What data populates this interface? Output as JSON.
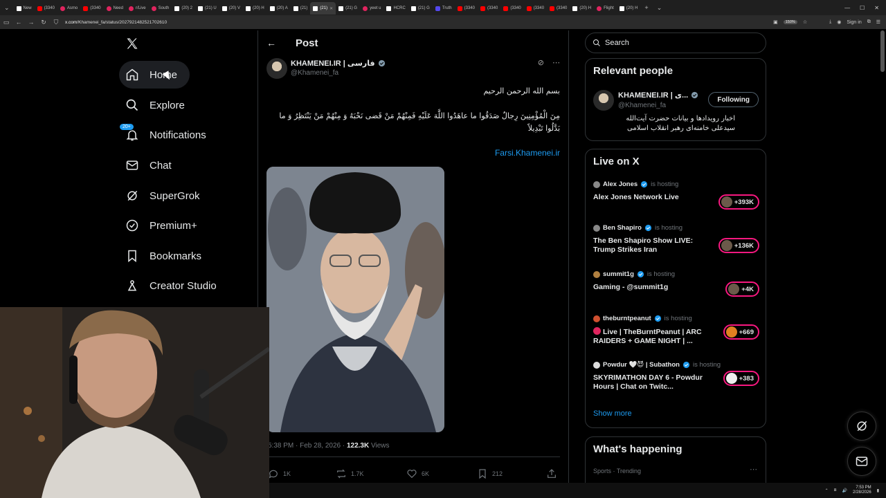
{
  "browser": {
    "tabs": [
      {
        "label": "New",
        "fav": "x"
      },
      {
        "label": "(3340",
        "fav": "yt"
      },
      {
        "label": "Asmo",
        "fav": ""
      },
      {
        "label": "(3340",
        "fav": "yt"
      },
      {
        "label": "Need",
        "fav": ""
      },
      {
        "label": "r/Live",
        "fav": ""
      },
      {
        "label": "South",
        "fav": ""
      },
      {
        "label": "(20) 2",
        "fav": "x"
      },
      {
        "label": "(21) U",
        "fav": "x"
      },
      {
        "label": "(20) V",
        "fav": "x"
      },
      {
        "label": "(20) H",
        "fav": "x"
      },
      {
        "label": "(20) A",
        "fav": "x"
      },
      {
        "label": "(21)",
        "fav": "x"
      },
      {
        "label": "(21)",
        "fav": "x"
      },
      {
        "label": "(21) G",
        "fav": "x"
      },
      {
        "label": "yeet u",
        "fav": ""
      },
      {
        "label": "HCRC",
        "fav": "x"
      },
      {
        "label": "(21) G",
        "fav": "x"
      },
      {
        "label": "Truth",
        "fav": "tr"
      },
      {
        "label": "(3340",
        "fav": "yt"
      },
      {
        "label": "(3340",
        "fav": "yt"
      },
      {
        "label": "(3340",
        "fav": "yt"
      },
      {
        "label": "(3340",
        "fav": "yt"
      },
      {
        "label": "(3340",
        "fav": "yt"
      },
      {
        "label": "(20) H",
        "fav": "x"
      },
      {
        "label": "Flight",
        "fav": ""
      },
      {
        "label": "(20) H",
        "fav": "x"
      }
    ],
    "active_tab_index": 13,
    "url_host": "x.com",
    "url_path": "/Khamenei_fa/status/2027921482521702610",
    "zoom": "150%",
    "signin_label": "Sign in"
  },
  "leftnav": {
    "items": [
      {
        "label": "Home",
        "icon": "home-icon"
      },
      {
        "label": "Explore",
        "icon": "search-icon"
      },
      {
        "label": "Notifications",
        "icon": "bell-icon",
        "badge": "20+"
      },
      {
        "label": "Chat",
        "icon": "mail-icon"
      },
      {
        "label": "SuperGrok",
        "icon": "grok-icon"
      },
      {
        "label": "Premium+",
        "icon": "verified-icon"
      },
      {
        "label": "Bookmarks",
        "icon": "bookmark-icon"
      },
      {
        "label": "Creator Studio",
        "icon": "creator-icon"
      }
    ]
  },
  "post": {
    "header_title": "Post",
    "author_name": "KHAMENEI.IR | فارسی",
    "author_handle": "@Khamenei_fa",
    "text_line1": "بسم الله الرحمن الرحیم",
    "text_line2": "مِنَ الْمُؤْمِنِينَ رِجالٌ صَدَقُوا ما عاهَدُوا اللَّهَ عَلَيْهِ فَمِنْهُمْ مَنْ قَضى نَحْبَهُ وَ مِنْهُمْ مَنْ يَنْتَظِرُ وَ ما بَدَّلُوا تَبْدِيلاً",
    "link": "Farsi.Khamenei.ir",
    "time": "5:38 PM · Feb 28, 2026 · ",
    "views_count": "122.3K",
    "views_label": " Views",
    "replies": "1K",
    "reposts": "1.7K",
    "likes": "6K",
    "bookmarks": "212"
  },
  "right": {
    "search_placeholder": "Search",
    "relevant_title": "Relevant people",
    "relevant_name": "KHAMENEI.IR | ی...",
    "relevant_handle": "@Khamenei_fa",
    "relevant_bio": "اخبار رویدادها و بیانات حضرت آیت‌الله سیدعلی خامنه‌ای رهبر انقلاب اسلامی",
    "follow_label": "Following",
    "live_title": "Live on X",
    "hosting_label": "is hosting",
    "live": [
      {
        "host": "Alex Jones",
        "title": "Alex Jones Network Live",
        "count": "+393K"
      },
      {
        "host": "Ben Shapiro",
        "title": "The Ben Shapiro Show LIVE: Trump Strikes Iran",
        "count": "+136K"
      },
      {
        "host": "summit1g",
        "title": "Gaming - @summit1g",
        "count": "+4K"
      },
      {
        "host": "theburntpeanut",
        "title": "Live | TheBurntPeanut | ARC RAIDERS + GAME NIGHT | ...",
        "count": "+669"
      },
      {
        "host": "Powdur 🤍😈 | Subathon",
        "title": "SKYRIMATHON DAY 6 - Powdur Hours | Chat on Twitc...",
        "count": "+383"
      }
    ],
    "show_more": "Show more",
    "happening_title": "What's happening",
    "trend_meta": "Sports · Trending"
  },
  "taskbar": {
    "time": "7:53 PM",
    "date": "2/28/2026"
  }
}
